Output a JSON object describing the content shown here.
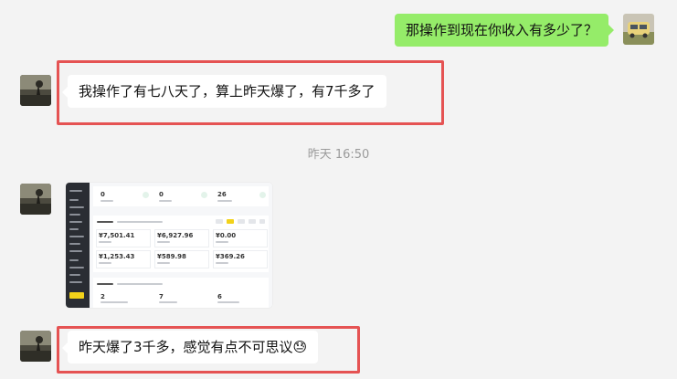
{
  "messages": [
    {
      "side": "right",
      "text": "那操作到现在你收入有多少了？"
    },
    {
      "side": "left",
      "text": "我操作了有七八天了，算上昨天爆了，有7千多了"
    },
    {
      "side": "left",
      "text": "昨天爆了3千多，感觉有点不可思议",
      "emoji": "😓"
    }
  ],
  "timestamp": "昨天 16:50",
  "screenshot": {
    "top_values": [
      "0",
      "0",
      "26"
    ],
    "row1": [
      "¥7,501.41",
      "¥6,927.96",
      "¥0.00"
    ],
    "row2": [
      "¥1,253.43",
      "¥589.98",
      "¥369.26"
    ],
    "bottom_values": [
      "2",
      "7",
      "6"
    ]
  },
  "colors": {
    "background": "#f3f3f3",
    "bubble_right": "#95ec69",
    "bubble_left": "#ffffff",
    "highlight": "#e55353"
  }
}
